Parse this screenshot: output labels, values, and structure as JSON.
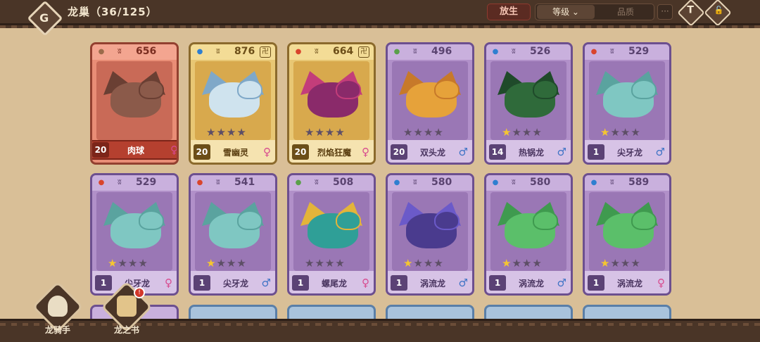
{
  "header": {
    "back_glyph": "G",
    "title": "龙巢（36/125）",
    "release_label": "放生",
    "sort_level_label": "等级 ⌄",
    "sort_quality_label": "品质",
    "more_label": "···",
    "filter_glyph": "T",
    "lock_glyph": "🔓"
  },
  "colors": {
    "fire": "#d9442c",
    "water": "#2f7fd0",
    "leaf": "#5aa04a",
    "earth": "#9b6b4a",
    "female": "#d74a8e",
    "male": "#3e73c5",
    "star": "#f5c630"
  },
  "cards": [
    {
      "power": "656",
      "level": "20",
      "name": "肉球",
      "gender": "♀",
      "gtype": "f",
      "element": "earth",
      "stars": 0,
      "quality": "red",
      "locked": false
    },
    {
      "power": "876",
      "level": "20",
      "name": "雪幽灵",
      "gender": "♀",
      "gtype": "f",
      "element": "water",
      "stars": 0,
      "quality": "gold",
      "locked": true
    },
    {
      "power": "664",
      "level": "20",
      "name": "烈焰狂魔",
      "gender": "♀",
      "gtype": "f",
      "element": "fire",
      "stars": 0,
      "quality": "gold",
      "locked": true
    },
    {
      "power": "496",
      "level": "20",
      "name": "双头龙",
      "gender": "♂",
      "gtype": "m",
      "element": "leaf",
      "stars": 0,
      "quality": "purple",
      "locked": false
    },
    {
      "power": "526",
      "level": "14",
      "name": "热锅龙",
      "gender": "♂",
      "gtype": "m",
      "element": "water",
      "stars": 1,
      "quality": "purple",
      "locked": false
    },
    {
      "power": "529",
      "level": "1",
      "name": "尖牙龙",
      "gender": "♂",
      "gtype": "m",
      "element": "fire",
      "stars": 1,
      "quality": "purple",
      "locked": false
    },
    {
      "power": "529",
      "level": "1",
      "name": "尖牙龙",
      "gender": "♀",
      "gtype": "f",
      "element": "fire",
      "stars": 1,
      "quality": "purple",
      "locked": false
    },
    {
      "power": "541",
      "level": "1",
      "name": "尖牙龙",
      "gender": "♂",
      "gtype": "m",
      "element": "fire",
      "stars": 1,
      "quality": "purple",
      "locked": false
    },
    {
      "power": "508",
      "level": "1",
      "name": "螺尾龙",
      "gender": "♀",
      "gtype": "f",
      "element": "leaf",
      "stars": 0,
      "quality": "purple",
      "locked": false
    },
    {
      "power": "580",
      "level": "1",
      "name": "涡流龙",
      "gender": "♂",
      "gtype": "m",
      "element": "water",
      "stars": 1,
      "quality": "purple",
      "locked": false
    },
    {
      "power": "580",
      "level": "1",
      "name": "涡流龙",
      "gender": "♂",
      "gtype": "m",
      "element": "water",
      "stars": 1,
      "quality": "purple",
      "locked": false
    },
    {
      "power": "589",
      "level": "1",
      "name": "涡流龙",
      "gender": "♀",
      "gtype": "f",
      "element": "water",
      "stars": 1,
      "quality": "purple",
      "locked": false
    }
  ],
  "nav": {
    "rider_label": "龙骑手",
    "book_label": "龙之书",
    "book_badge": "!"
  }
}
